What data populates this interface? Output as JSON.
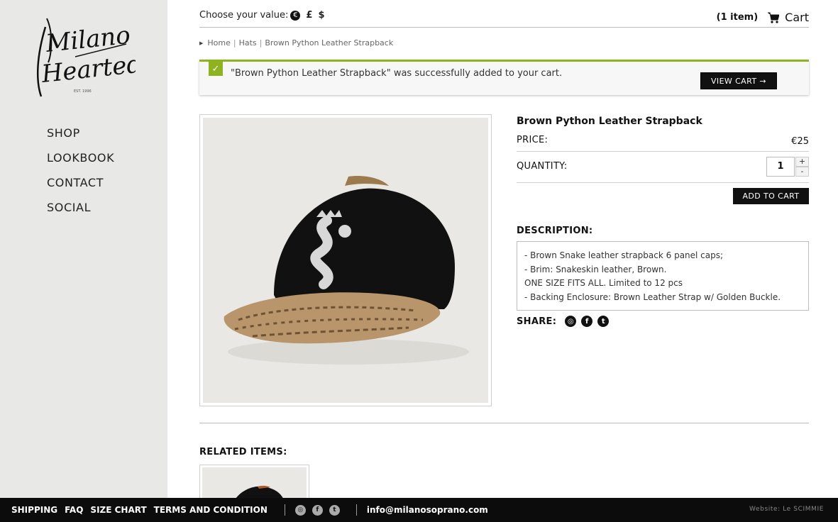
{
  "brand": {
    "logo_text_line1": "Milano",
    "logo_text_line2": "Hearted",
    "logo_small": "EST. 1996"
  },
  "sidebar": {
    "items": [
      {
        "label": "SHOP"
      },
      {
        "label": "LOOKBOOK"
      },
      {
        "label": "CONTACT"
      },
      {
        "label": "SOCIAL"
      }
    ]
  },
  "topbar": {
    "currency_label": "Choose your value:",
    "currency_euro": "€",
    "currency_pound": "£",
    "currency_dollar": "$",
    "cart_count": "(1 item)",
    "cart_label": "Cart"
  },
  "breadcrumb": {
    "home": "Home",
    "category": "Hats",
    "current": "Brown Python Leather Strapback",
    "separator": "|"
  },
  "notice": {
    "check": "✓",
    "message": "\"Brown Python Leather Strapback\" was successfully added to your cart.",
    "button": "VIEW CART →",
    "accent": "#8fb31f"
  },
  "product": {
    "title": "Brown Python Leather Strapback",
    "price_label": "PRICE:",
    "price": "€25",
    "quantity_label": "QUANTITY:",
    "quantity": "1",
    "qty_plus": "+",
    "qty_minus": "-",
    "add_to_cart": "ADD TO CART",
    "description_label": "DESCRIPTION:",
    "description": [
      "- Brown Snake leather strapback 6 panel caps;",
      "- Brim: Snakeskin leather, Brown.",
      "ONE SIZE FITS ALL. Limited to 12 pcs",
      "- Backing Enclosure: Brown Leather Strap w/ Golden Buckle."
    ],
    "share_label": "SHARE:",
    "share_icons": [
      "instagram-icon",
      "facebook-icon",
      "tumblr-icon"
    ]
  },
  "related": {
    "title": "RELATED ITEMS:"
  },
  "footer": {
    "links": [
      "SHIPPING",
      "FAQ",
      "SIZE CHART",
      "TERMS AND CONDITION"
    ],
    "email": "info@milanosoprano.com",
    "credit": "Website: Le SCIMMIE"
  }
}
